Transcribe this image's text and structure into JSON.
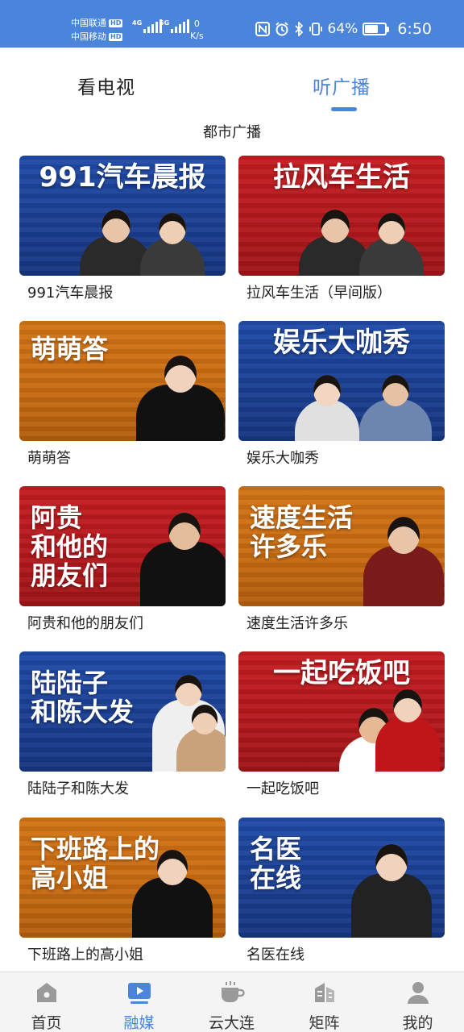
{
  "status_bar": {
    "carrier_1": "中国联通",
    "carrier_2": "中国移动",
    "hd_badge": "HD",
    "network_1": "4G",
    "network_2": "5G",
    "net_speed_value": "0",
    "net_speed_unit": "K/s",
    "battery_percent": "64%",
    "battery_level": 0.64,
    "time": "6:50",
    "icons": [
      "nfc-icon",
      "alarm-icon",
      "bluetooth-icon",
      "vibrate-icon",
      "battery-icon"
    ]
  },
  "top_tabs": [
    {
      "label": "看电视",
      "active": false
    },
    {
      "label": "听广播",
      "active": true
    }
  ],
  "accent_color": "#4a84db",
  "section_title": "都市广播",
  "programs": [
    {
      "banner": "991汽车晨报",
      "title": "991汽车晨报",
      "theme": "blue"
    },
    {
      "banner": "拉风车生活",
      "title": "拉风车生活（早间版）",
      "theme": "red"
    },
    {
      "banner": "萌萌答",
      "title": "萌萌答",
      "theme": "orange"
    },
    {
      "banner": "娱乐大咖秀",
      "title": "娱乐大咖秀",
      "theme": "blue"
    },
    {
      "banner": "阿贵\n和他的\n朋友们",
      "title": "阿贵和他的朋友们",
      "theme": "red"
    },
    {
      "banner": "速度生活\n许多乐",
      "title": "速度生活许多乐",
      "theme": "orange"
    },
    {
      "banner": "陆陆子\n和陈大发",
      "title": "陆陆子和陈大发",
      "theme": "blue"
    },
    {
      "banner": "一起吃饭吧",
      "title": "一起吃饭吧",
      "theme": "red"
    },
    {
      "banner": "下班路上的\n高小姐",
      "title": "下班路上的高小姐",
      "theme": "orange"
    },
    {
      "banner": "名医\n在线",
      "title": "名医在线",
      "theme": "blue"
    }
  ],
  "bottom_nav": [
    {
      "label": "首页",
      "icon": "home-icon",
      "active": false
    },
    {
      "label": "融媒",
      "icon": "media-play-icon",
      "active": true
    },
    {
      "label": "云大连",
      "icon": "cup-icon",
      "active": false
    },
    {
      "label": "矩阵",
      "icon": "matrix-icon",
      "active": false
    },
    {
      "label": "我的",
      "icon": "user-icon",
      "active": false
    }
  ]
}
